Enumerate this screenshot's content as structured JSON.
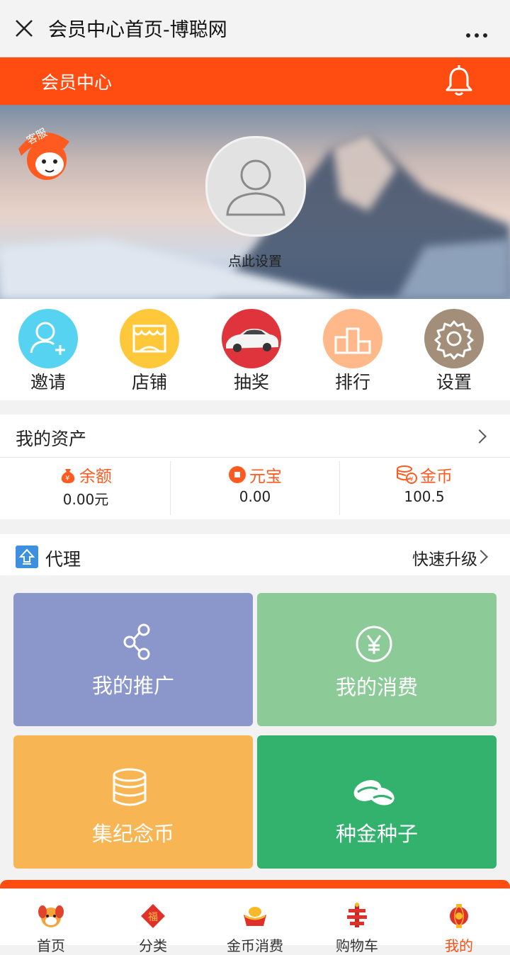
{
  "window": {
    "title": "会员中心首页-博聪网"
  },
  "header": {
    "label": "会员中心"
  },
  "hero": {
    "service_badge": "客服",
    "set_label": "点此设置"
  },
  "quick_actions": [
    {
      "label": "邀请",
      "color": "#56d3f0"
    },
    {
      "label": "店铺",
      "color": "#ffc83a"
    },
    {
      "label": "抽奖",
      "color": "#e0343c"
    },
    {
      "label": "排行",
      "color": "#ffb889"
    },
    {
      "label": "设置",
      "color": "#a38f79"
    }
  ],
  "assets": {
    "title": "我的资产",
    "items": [
      {
        "name": "余额",
        "value": "0.00元"
      },
      {
        "name": "元宝",
        "value": "0.00"
      },
      {
        "name": "金币",
        "value": "100.5"
      }
    ]
  },
  "agent": {
    "title": "代理",
    "upgrade": "快速升级"
  },
  "tiles": [
    {
      "label": "我的推广",
      "color": "#8b96cb"
    },
    {
      "label": "我的消费",
      "color": "#8ccb98"
    },
    {
      "label": "集纪念币",
      "color": "#f8b553"
    },
    {
      "label": "种金种子",
      "color": "#33b26e"
    }
  ],
  "tabbar": {
    "items": [
      {
        "label": "首页",
        "icon": "dog-icon"
      },
      {
        "label": "分类",
        "icon": "fu-icon"
      },
      {
        "label": "金币消费",
        "icon": "ingot-icon"
      },
      {
        "label": "购物车",
        "icon": "cart-icon"
      },
      {
        "label": "我的",
        "icon": "lantern-icon"
      }
    ],
    "active_index": 4
  },
  "colors": {
    "brand": "#ff4d12"
  }
}
